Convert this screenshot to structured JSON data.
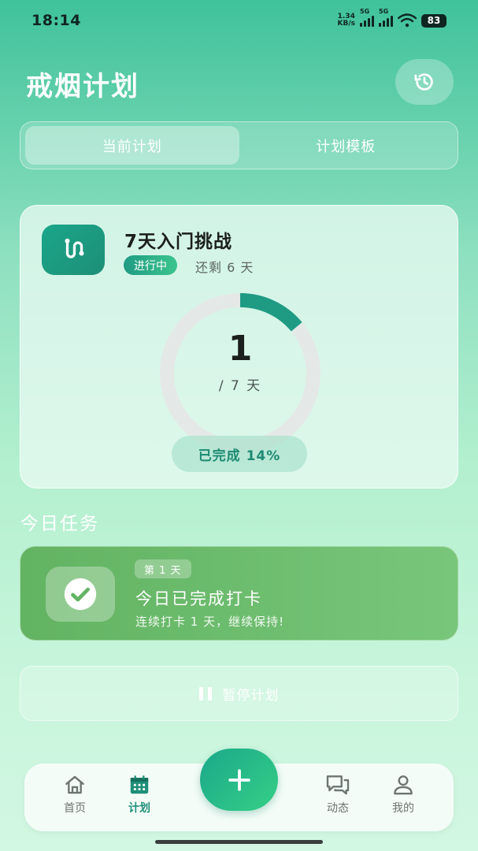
{
  "status_bar": {
    "time": "18:14",
    "net_speed_value": "1.34",
    "net_speed_unit": "KB/s",
    "signal1_label": "5G",
    "signal2_label": "5G",
    "battery": "83"
  },
  "header": {
    "title": "戒烟计划",
    "history_icon": "history-icon"
  },
  "segment": {
    "tabs": [
      {
        "label": "当前计划",
        "active": true
      },
      {
        "label": "计划模板",
        "active": false
      }
    ]
  },
  "plan": {
    "name": "7天入门挑战",
    "status": "进行中",
    "remaining": "还剩 6 天",
    "current_day": "1",
    "total_label": "/ 7 天",
    "progress": 0.14,
    "completed_label": "已完成 14%",
    "icon": "route-icon",
    "colors": {
      "accent": "#1f9b83",
      "ring_track": "#e4e9e7"
    }
  },
  "today_tasks": {
    "section_title": "今日任务",
    "day_badge": "第 1 天",
    "title": "今日已完成打卡",
    "subtitle": "连续打卡 1 天，继续保持!",
    "icon": "check-circle-icon"
  },
  "pause": {
    "label": "暂停计划",
    "icon": "pause-icon"
  },
  "tab_bar": {
    "items": [
      {
        "label": "首页",
        "icon": "home-icon",
        "active": false
      },
      {
        "label": "计划",
        "icon": "calendar-icon",
        "active": true
      },
      {
        "label": "动态",
        "icon": "chat-icon",
        "active": false
      },
      {
        "label": "我的",
        "icon": "user-icon",
        "active": false
      }
    ],
    "fab_icon": "plus-icon"
  }
}
